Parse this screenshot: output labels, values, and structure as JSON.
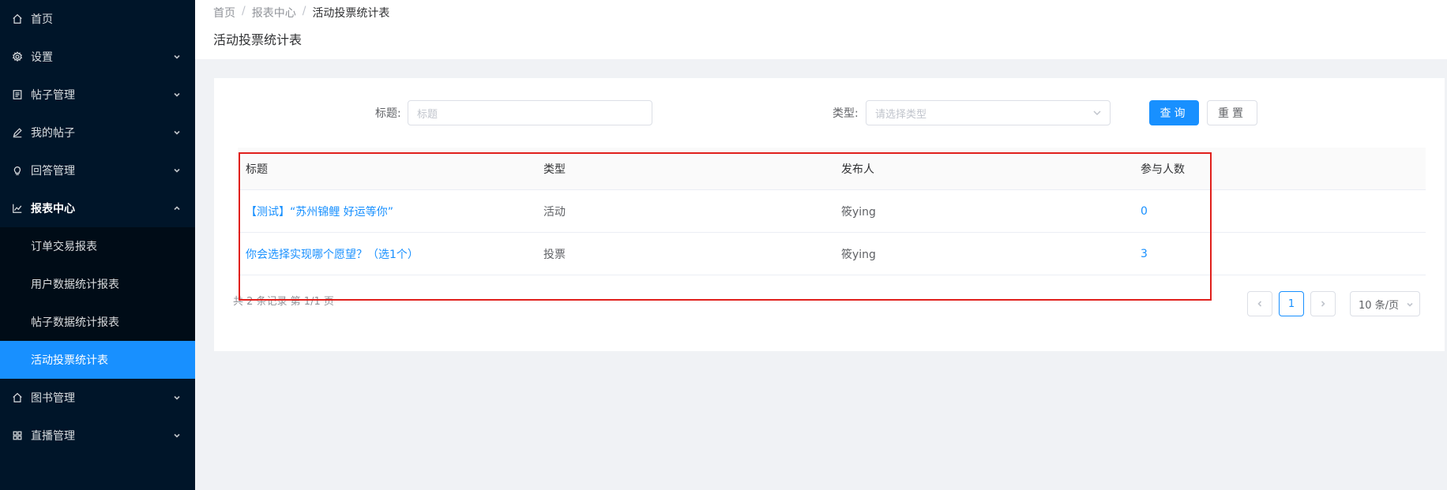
{
  "sidebar": {
    "items": [
      {
        "label": "首页",
        "icon": "home-icon",
        "arrow": ""
      },
      {
        "label": "设置",
        "icon": "gear-icon",
        "arrow": "down"
      },
      {
        "label": "帖子管理",
        "icon": "document-icon",
        "arrow": "down"
      },
      {
        "label": "我的帖子",
        "icon": "edit-icon",
        "arrow": "down"
      },
      {
        "label": "回答管理",
        "icon": "lightbulb-icon",
        "arrow": "down"
      },
      {
        "label": "报表中心",
        "icon": "line-chart-icon",
        "arrow": "up"
      },
      {
        "label": "图书管理",
        "icon": "home-icon",
        "arrow": "down"
      },
      {
        "label": "直播管理",
        "icon": "grid-icon",
        "arrow": "down"
      }
    ],
    "submenu": [
      {
        "label": "订单交易报表"
      },
      {
        "label": "用户数据统计报表"
      },
      {
        "label": "帖子数据统计报表"
      },
      {
        "label": "活动投票统计表",
        "active": true
      }
    ]
  },
  "header": {
    "breadcrumb": [
      "首页",
      "报表中心",
      "活动投票统计表"
    ],
    "separator": "/",
    "title": "活动投票统计表"
  },
  "filters": {
    "title_label": "标题:",
    "title_placeholder": "标题",
    "type_label": "类型:",
    "type_placeholder": "请选择类型",
    "search_button": "查询",
    "reset_button": "重置"
  },
  "table": {
    "columns": [
      "标题",
      "类型",
      "发布人",
      "参与人数"
    ],
    "rows": [
      {
        "title": "【测试】“苏州锦鲤 好运等你”",
        "type": "活动",
        "publisher": "筱ying",
        "count": "0"
      },
      {
        "title": "你会选择实现哪个愿望？（选1个）",
        "type": "投票",
        "publisher": "筱ying",
        "count": "3"
      }
    ]
  },
  "pagination": {
    "total_text": "共 2 条记录 第 1/1 页",
    "current_page": "1",
    "page_size": "10 条/页"
  },
  "colors": {
    "sidebar_bg": "#001529",
    "accent": "#1890ff",
    "highlight_border": "#e0201c"
  }
}
